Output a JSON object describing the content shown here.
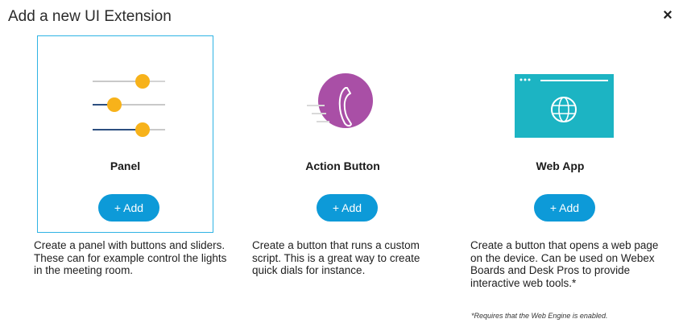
{
  "dialog": {
    "title": "Add a new UI Extension",
    "close_icon": "×"
  },
  "cards": [
    {
      "title": "Panel",
      "icon": "sliders-icon",
      "add_label": "+ Add",
      "selected": true,
      "description": "Create a panel with buttons and sliders. These can for example control the lights in the meeting room."
    },
    {
      "title": "Action Button",
      "icon": "phone-call-icon",
      "add_label": "+ Add",
      "selected": false,
      "description": "Create a button that runs a custom script. This is a great way to create quick dials for instance."
    },
    {
      "title": "Web App",
      "icon": "globe-browser-icon",
      "add_label": "+ Add",
      "selected": false,
      "description": "Create a button that opens a web page on the device. Can be used on Webex Boards and Desk Pros to provide interactive web tools.*"
    }
  ],
  "footnote": "*Requires that the Web Engine is enabled.",
  "colors": {
    "accent": "#0d9ad8",
    "selection_border": "#2fb3e4",
    "slider_knob": "#f7b21a",
    "action_circle": "#a94fa6",
    "web_screen": "#1cb4c3"
  }
}
